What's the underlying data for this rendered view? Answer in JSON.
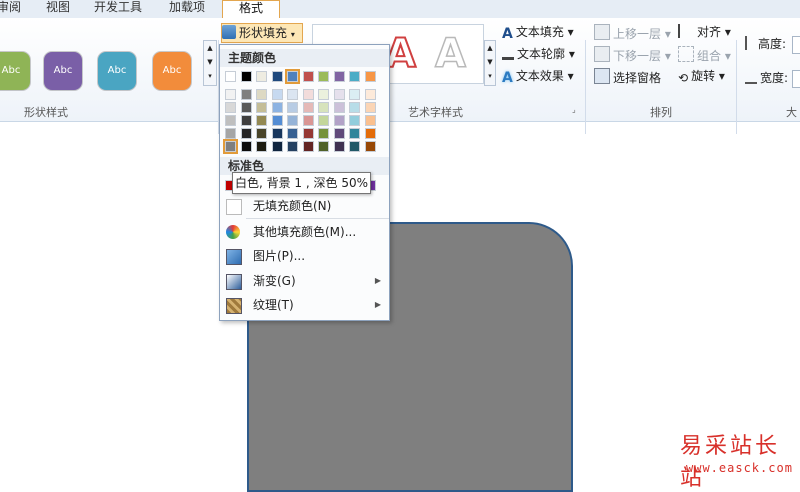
{
  "tabs": [
    {
      "label": "审阅"
    },
    {
      "label": "视图"
    },
    {
      "label": "开发工具"
    },
    {
      "label": "加载项"
    },
    {
      "label": "格式"
    }
  ],
  "ribbon": {
    "shape_style_label": "形状样式",
    "art_text_label": "艺术字样式",
    "arrange_label": "排列",
    "size_label_partial": "大",
    "swatch_text": "Abc",
    "shape_fill": "形状填充",
    "text_fill": "文本填充",
    "text_outline": "文本轮廓",
    "text_effects": "文本效果",
    "bring_forward": "上移一层",
    "send_backward": "下移一层",
    "selection_pane": "选择窗格",
    "align": "对齐",
    "group": "组合",
    "rotate": "旋转",
    "height_label": "高度:",
    "width_label": "宽度:"
  },
  "dropdown": {
    "theme_colors_header": "主题颜色",
    "standard_colors_header": "标准色",
    "no_fill": "无填充颜色(N)",
    "more_fill": "其他填充颜色(M)...",
    "picture": "图片(P)...",
    "gradient": "渐变(G)",
    "texture": "纹理(T)",
    "theme_top_row": [
      "#ffffff",
      "#000000",
      "#eeece1",
      "#1f497d",
      "#4f81bd",
      "#c0504d",
      "#9bbb59",
      "#8064a2",
      "#4bacc6",
      "#f79646"
    ],
    "theme_shades": [
      [
        "#f2f2f2",
        "#7f7f7f",
        "#ddd9c3",
        "#c6d9f0",
        "#dbe5f1",
        "#f2dcdb",
        "#ebf1dd",
        "#e5e0ec",
        "#dbeef3",
        "#fdeada"
      ],
      [
        "#d8d8d8",
        "#595959",
        "#c4bd97",
        "#8db3e2",
        "#b8cce4",
        "#e5b9b7",
        "#d7e3bc",
        "#ccc1d9",
        "#b7dde8",
        "#fbd5b5"
      ],
      [
        "#bfbfbf",
        "#3f3f3f",
        "#938953",
        "#548dd4",
        "#95b3d7",
        "#d99694",
        "#c3d69b",
        "#b2a2c7",
        "#92cddc",
        "#fac08f"
      ],
      [
        "#a5a5a5",
        "#262626",
        "#494429",
        "#17365d",
        "#366092",
        "#953734",
        "#76923c",
        "#5f497a",
        "#31859b",
        "#e36c09"
      ],
      [
        "#7f7f7f",
        "#0c0c0c",
        "#1d1b10",
        "#0f243e",
        "#244061",
        "#632423",
        "#4f6128",
        "#3f3151",
        "#205867",
        "#974806"
      ]
    ],
    "standard_colors": [
      "#c00000",
      "#ff0000",
      "#ffc000",
      "#ffff00",
      "#92d050",
      "#00b050",
      "#00b0f0",
      "#0070c0",
      "#002060",
      "#7030a0"
    ]
  },
  "tooltip": "白色, 背景 1 , 深色 50%",
  "canvas": {
    "shape_fill": "#7f7f7f"
  },
  "watermark": {
    "title": "易采站长站",
    "url": "www.easck.com"
  }
}
